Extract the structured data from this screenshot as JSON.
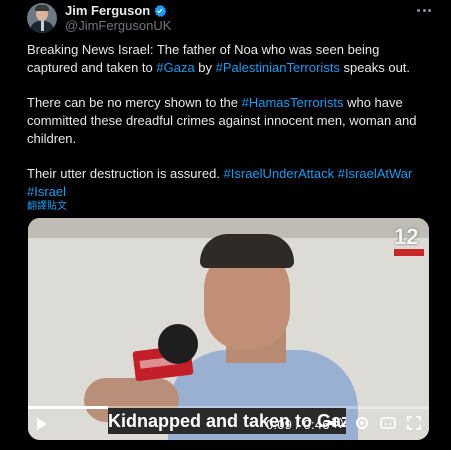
{
  "author": {
    "name": "Jim Ferguson",
    "handle": "@JimFergusonUK",
    "verified_color": "#1d9bf0"
  },
  "tweet": {
    "p1_a": "Breaking News Israel: The father of Noa who was seen being captured and taken to ",
    "p1_tag1": "#Gaza",
    "p1_b": " by ",
    "p1_tag2": "#PalestinianTerrorists",
    "p1_c": " speaks out.",
    "p2_a": "There can be no mercy shown to the ",
    "p2_tag1": "#HamasTerrorists",
    "p2_b": " who have committed these dreadful crimes against innocent men, woman and children.",
    "p3_a": "Their utter destruction is assured. ",
    "p3_tag1": "#IsraelUnderAttack",
    "p3_tag2": "#IsraelAtWar",
    "p3_tag3": "#Israel",
    "translate": "翻譯貼文",
    "hashtag_color": "#1d9bf0"
  },
  "video": {
    "channel_logo": "12",
    "caption": "Kidnapped and taken to Gaza",
    "time": "0:09 / 0:46",
    "progress_fraction": 0.2,
    "icons": [
      "play-icon",
      "volume-icon",
      "settings-icon",
      "captions-icon",
      "fullscreen-icon"
    ]
  }
}
